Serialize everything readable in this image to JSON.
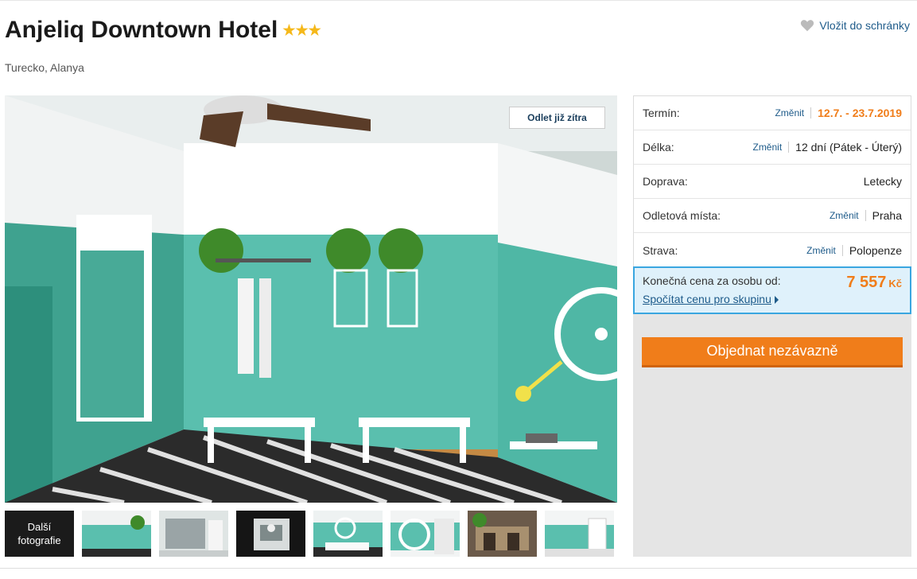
{
  "hotel": {
    "name": "Anjeliq Downtown Hotel",
    "stars": "★★★",
    "location": "Turecko, Alanya",
    "favorite_label": "Vložit do schránky"
  },
  "gallery": {
    "badge": "Odlet již zítra",
    "more_photos_line1": "Další",
    "more_photos_line2": "fotografie",
    "thumb_count": 7
  },
  "booking": {
    "rows": [
      {
        "label": "Termín:",
        "change": "Změnit",
        "value": "12.7. - 23.7.2019"
      },
      {
        "label": "Délka:",
        "change": "Změnit",
        "value": "12 dní (Pátek - Úterý)"
      },
      {
        "label": "Doprava:",
        "change": "",
        "value": "Letecky"
      },
      {
        "label": "Odletová místa:",
        "change": "Změnit",
        "value": "Praha"
      },
      {
        "label": "Strava:",
        "change": "Změnit",
        "value": "Polopenze"
      }
    ],
    "price_label": "Konečná cena za osobu od:",
    "price_value": "7 557",
    "price_currency": "Kč",
    "group_link": "Spočítat cenu pro skupinu",
    "order_button": "Objednat nezávazně"
  },
  "colors": {
    "accent_orange": "#f07d1a",
    "link_blue": "#1e5b8a",
    "price_box_border": "#3aa6e0",
    "star_yellow": "#f5b81a"
  }
}
